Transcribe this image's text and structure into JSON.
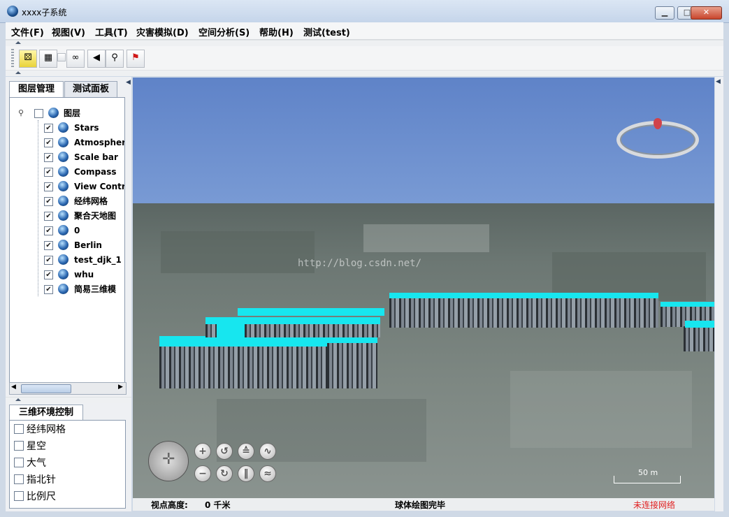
{
  "window": {
    "title": "xxxx子系统",
    "minimize": "▁",
    "maximize": "□",
    "close": "✕"
  },
  "menu": {
    "items": [
      "文件(F)",
      "视图(V)",
      "工具(T)",
      "灾害模拟(D)",
      "空间分析(S)",
      "帮助(H)",
      "测试(test)"
    ]
  },
  "toolbar": {
    "icons": [
      "dice-icon",
      "map-icon",
      "small-checkbox",
      "binoculars-icon",
      "speaker-icon",
      "magnifier-icon",
      "flag-icon"
    ]
  },
  "left_panel": {
    "tabs": [
      "图层管理",
      "测试面板"
    ],
    "tree": {
      "root": "图层",
      "layers": [
        "Stars",
        "Atmospher",
        "Scale bar",
        "Compass",
        "View Contr",
        "经纬网格",
        "聚合天地图",
        "0",
        "Berlin",
        "test_djk_1",
        "whu",
        "简易三维模"
      ]
    },
    "env_tab": "三维环境控制",
    "env_options": [
      "经纬网格",
      "星空",
      "大气",
      "指北针",
      "比例尺"
    ]
  },
  "view": {
    "watermark": "http://blog.csdn.net/",
    "scale": "50 m",
    "roof_color": "#17e6ef"
  },
  "status": {
    "eye_label": "视点高度:",
    "eye_value": "0 千米",
    "render_status": "球体绘图完毕",
    "network_status": "未连接网络",
    "network_color": "#e02020"
  }
}
